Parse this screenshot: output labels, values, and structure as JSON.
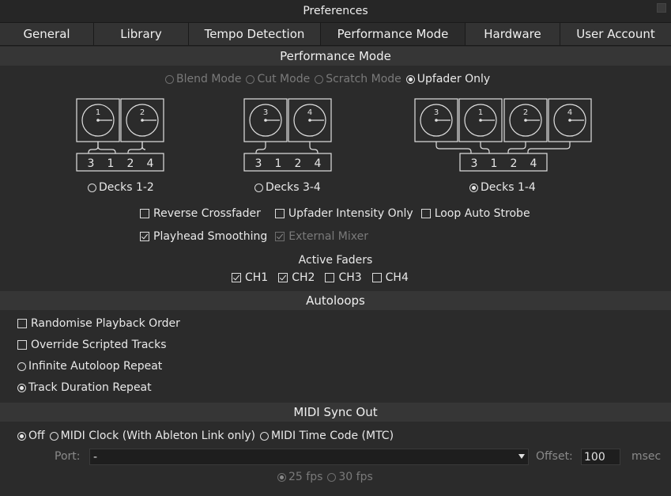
{
  "window": {
    "title": "Preferences"
  },
  "tabs": [
    {
      "label": "General"
    },
    {
      "label": "Library"
    },
    {
      "label": "Tempo Detection"
    },
    {
      "label": "Performance Mode",
      "active": true
    },
    {
      "label": "Hardware"
    },
    {
      "label": "User Account"
    }
  ],
  "performance": {
    "header": "Performance Mode",
    "modes": [
      {
        "label": "Blend Mode",
        "selected": false,
        "enabled": false
      },
      {
        "label": "Cut Mode",
        "selected": false,
        "enabled": false
      },
      {
        "label": "Scratch Mode",
        "selected": false,
        "enabled": false
      },
      {
        "label": "Upfader Only",
        "selected": true,
        "enabled": true
      }
    ],
    "deck_options": [
      {
        "label": "Decks 1-2",
        "selected": false,
        "decks": [
          "1",
          "2"
        ],
        "channels": [
          "3",
          "1",
          "2",
          "4"
        ]
      },
      {
        "label": "Decks 3-4",
        "selected": false,
        "decks": [
          "3",
          "4"
        ],
        "channels": [
          "3",
          "1",
          "2",
          "4"
        ]
      },
      {
        "label": "Decks 1-4",
        "selected": true,
        "decks": [
          "3",
          "1",
          "2",
          "4"
        ],
        "channels": [
          "3",
          "1",
          "2",
          "4"
        ]
      }
    ],
    "options_row1": [
      {
        "label": "Reverse Crossfader",
        "checked": false,
        "enabled": true
      },
      {
        "label": "Upfader Intensity Only",
        "checked": false,
        "enabled": true
      },
      {
        "label": "Loop Auto Strobe",
        "checked": false,
        "enabled": true
      }
    ],
    "options_row2": [
      {
        "label": "Playhead Smoothing",
        "checked": true,
        "enabled": true
      },
      {
        "label": "External Mixer",
        "checked": true,
        "enabled": false
      }
    ],
    "active_faders_label": "Active Faders",
    "faders": [
      {
        "label": "CH1",
        "checked": true
      },
      {
        "label": "CH2",
        "checked": true
      },
      {
        "label": "CH3",
        "checked": false
      },
      {
        "label": "CH4",
        "checked": false
      }
    ]
  },
  "autoloops": {
    "header": "Autoloops",
    "randomise": {
      "label": "Randomise Playback Order",
      "checked": false
    },
    "override": {
      "label": "Override Scripted Tracks",
      "checked": false
    },
    "infinite": {
      "label": "Infinite Autoloop Repeat",
      "selected": false
    },
    "duration": {
      "label": "Track Duration Repeat",
      "selected": true
    }
  },
  "midi": {
    "header": "MIDI Sync Out",
    "modes": [
      {
        "label": "Off",
        "selected": true
      },
      {
        "label": "MIDI Clock (With Ableton Link only)",
        "selected": false
      },
      {
        "label": "MIDI Time Code (MTC)",
        "selected": false
      }
    ],
    "port_label": "Port:",
    "port_value": "-",
    "offset_label": "Offset:",
    "offset_value": "100",
    "offset_unit": "msec",
    "fps": [
      {
        "label": "25 fps",
        "selected": true
      },
      {
        "label": "30 fps",
        "selected": false
      }
    ]
  }
}
